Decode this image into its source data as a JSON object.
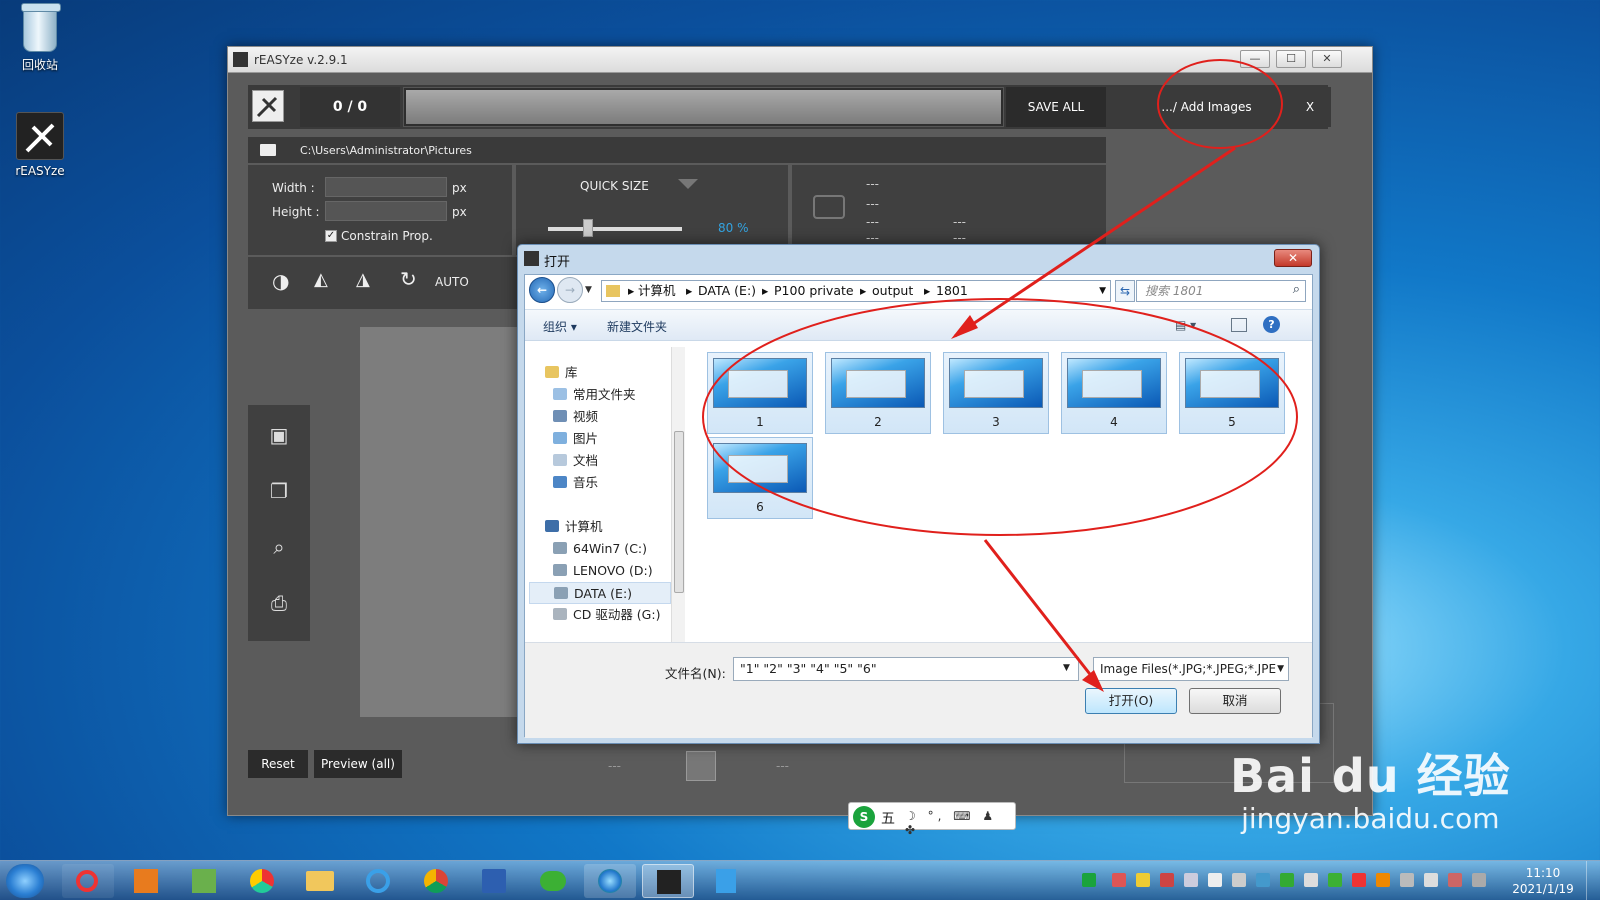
{
  "desktop": {
    "icons": [
      {
        "label": "回收站"
      },
      {
        "label": "rEASYze"
      }
    ]
  },
  "app": {
    "title": "rEASYze v.2.9.1",
    "counter": "0 / 0",
    "save_all": "SAVE ALL",
    "add_images": ".../ Add Images",
    "close_x": "X",
    "path": "C:\\Users\\Administrator\\Pictures",
    "width_label": "Width :",
    "height_label": "Height :",
    "px": "px",
    "constrain": "Constrain Prop.",
    "quick_size": "QUICK SIZE",
    "percent": "80 %",
    "auto": "AUTO",
    "dashes": "---",
    "reset": "Reset",
    "preview_all": "Preview (all)",
    "slider_fraction": 0.28
  },
  "dialog": {
    "title": "打开",
    "breadcrumb": [
      "计算机",
      "DATA (E:)",
      "P100 private",
      "output",
      "1801"
    ],
    "search_placeholder": "搜索 1801",
    "organize": "组织 ▾",
    "new_folder": "新建文件夹",
    "nav": {
      "libraries": "库",
      "lib_items": [
        "常用文件夹",
        "视频",
        "图片",
        "文档",
        "音乐"
      ],
      "computer": "计算机",
      "drives": [
        "64Win7 (C:)",
        "LENOVO (D:)",
        "DATA (E:)",
        "CD 驱动器 (G:)"
      ]
    },
    "files": [
      "1",
      "2",
      "3",
      "4",
      "5",
      "6"
    ],
    "filename_label": "文件名(N):",
    "filename_value": "\"1\" \"2\" \"3\" \"4\" \"5\" \"6\"",
    "filetype": "Image Files(*.JPG;*.JPEG;*.JPE",
    "open": "打开(O)",
    "cancel": "取消"
  },
  "ime": {
    "label": "五"
  },
  "watermark": {
    "brand": "Bai du 经验",
    "url": "jingyan.baidu.com"
  },
  "taskbar": {
    "time": "11:10",
    "date": "2021/1/19"
  },
  "colors": {
    "annotation": "#e0201c",
    "accent_percent": "#33a3e0"
  }
}
